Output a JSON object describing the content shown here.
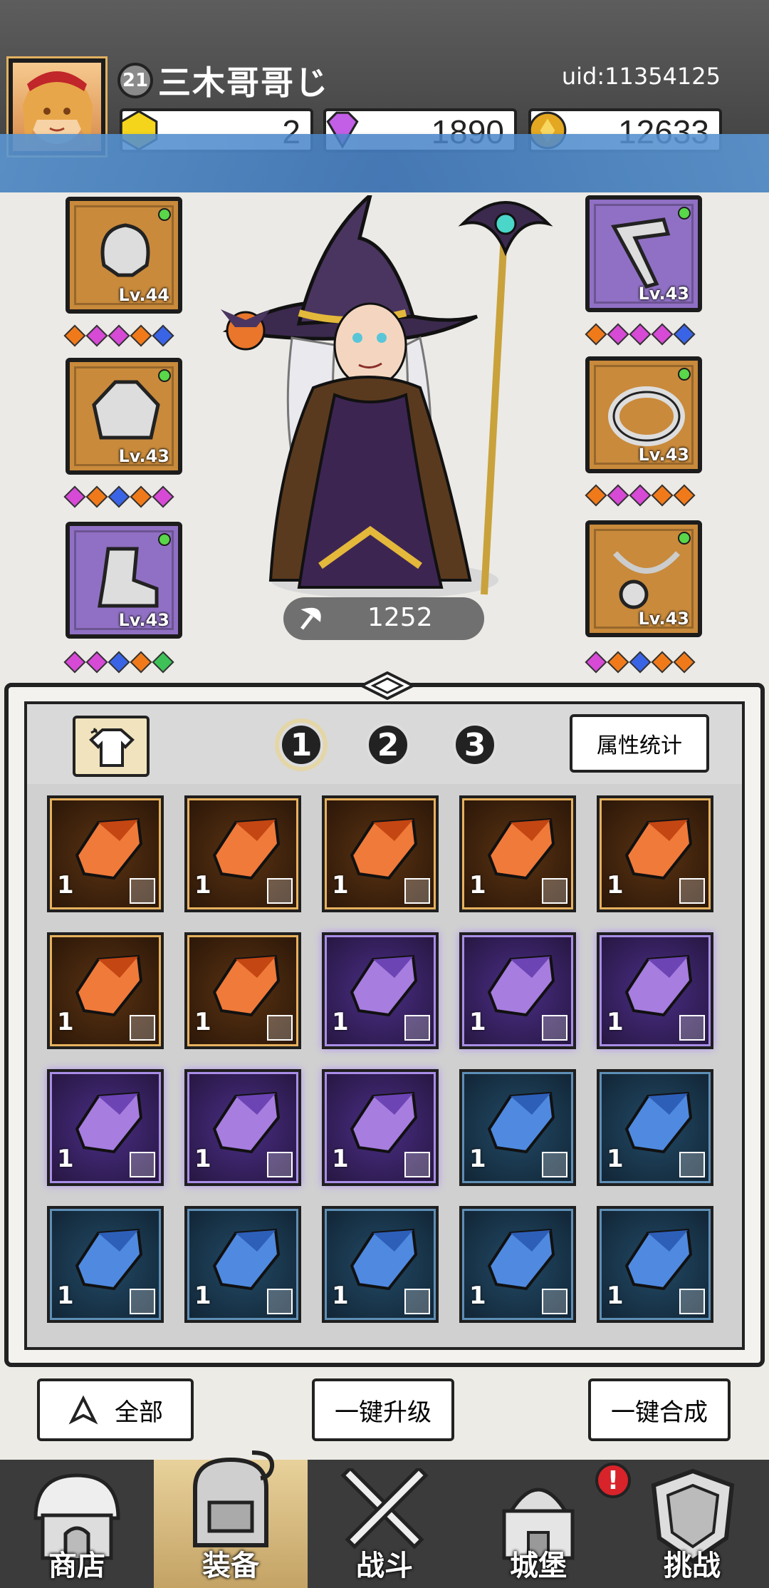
{
  "header": {
    "level": "21",
    "username": "三木哥哥じ",
    "uid": "uid:11354125",
    "resources": [
      {
        "icon": "gold-crystal-icon",
        "value": "2"
      },
      {
        "icon": "diamond-icon",
        "value": "1890"
      },
      {
        "icon": "coin-icon",
        "value": "12633"
      }
    ]
  },
  "equipment": {
    "left": [
      {
        "name": "helmet",
        "level": "Lv.44",
        "rarity": "gold"
      },
      {
        "name": "armor",
        "level": "Lv.43",
        "rarity": "gold"
      },
      {
        "name": "boots",
        "level": "Lv.43",
        "rarity": "purple"
      }
    ],
    "right": [
      {
        "name": "weapon",
        "level": "Lv.43",
        "rarity": "purple"
      },
      {
        "name": "ring",
        "level": "Lv.43",
        "rarity": "gold"
      },
      {
        "name": "necklace",
        "level": "Lv.43",
        "rarity": "gold"
      }
    ],
    "gem_rows": {
      "left1": [
        "#f07a1a",
        "#d64ad6",
        "#d64ad6",
        "#f07a1a",
        "#3a64e6"
      ],
      "right1": [
        "#f07a1a",
        "#d64ad6",
        "#d64ad6",
        "#d64ad6",
        "#3a64e6"
      ],
      "left2": [
        "#d64ad6",
        "#f07a1a",
        "#3a64e6",
        "#f07a1a",
        "#d64ad6"
      ],
      "right2": [
        "#f07a1a",
        "#d64ad6",
        "#d64ad6",
        "#f07a1a",
        "#f07a1a"
      ],
      "left3": [
        "#d64ad6",
        "#d64ad6",
        "#3a64e6",
        "#f07a1a",
        "#3ec258"
      ],
      "right3": [
        "#d64ad6",
        "#f07a1a",
        "#3a64e6",
        "#f07a1a",
        "#f07a1a"
      ]
    },
    "power": "1252"
  },
  "tabs": {
    "labels": [
      "1",
      "2",
      "3"
    ],
    "active": "1",
    "stats_button": "属性统计"
  },
  "inventory": [
    {
      "rarity": "orange",
      "count": "1"
    },
    {
      "rarity": "orange",
      "count": "1"
    },
    {
      "rarity": "orange",
      "count": "1"
    },
    {
      "rarity": "orange",
      "count": "1"
    },
    {
      "rarity": "orange",
      "count": "1"
    },
    {
      "rarity": "orange",
      "count": "1"
    },
    {
      "rarity": "orange",
      "count": "1"
    },
    {
      "rarity": "purple",
      "count": "1"
    },
    {
      "rarity": "purple",
      "count": "1"
    },
    {
      "rarity": "purple",
      "count": "1"
    },
    {
      "rarity": "purple",
      "count": "1"
    },
    {
      "rarity": "purple",
      "count": "1"
    },
    {
      "rarity": "purple",
      "count": "1"
    },
    {
      "rarity": "blue",
      "count": "1"
    },
    {
      "rarity": "blue",
      "count": "1"
    },
    {
      "rarity": "blue",
      "count": "1"
    },
    {
      "rarity": "blue",
      "count": "1"
    },
    {
      "rarity": "blue",
      "count": "1"
    },
    {
      "rarity": "blue",
      "count": "1"
    },
    {
      "rarity": "blue",
      "count": "1"
    }
  ],
  "actions": {
    "filter": "全部",
    "upgrade_all": "一键升级",
    "merge_all": "一键合成"
  },
  "nav": [
    {
      "label": "商店",
      "icon": "shop-icon"
    },
    {
      "label": "装备",
      "icon": "backpack-icon"
    },
    {
      "label": "战斗",
      "icon": "crossed-swords-icon"
    },
    {
      "label": "城堡",
      "icon": "castle-icon"
    },
    {
      "label": "挑战",
      "icon": "shield-icon"
    }
  ],
  "notification": "!"
}
